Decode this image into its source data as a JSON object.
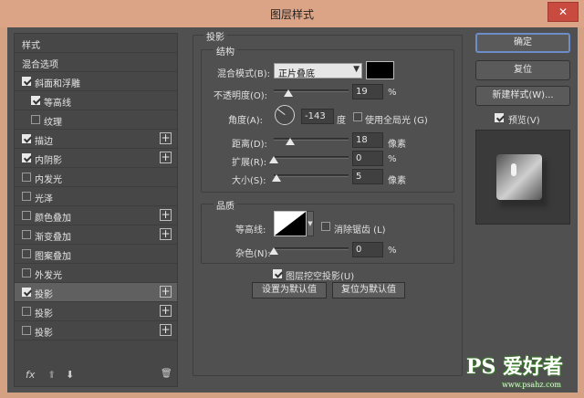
{
  "window": {
    "title": "图层样式",
    "close": "✕"
  },
  "styles_list": {
    "items": [
      {
        "label": "样式",
        "checkbox": false,
        "plus": false,
        "indent": 0,
        "selected": false
      },
      {
        "label": "混合选项",
        "checkbox": false,
        "plus": false,
        "indent": 0,
        "selected": false
      },
      {
        "label": "斜面和浮雕",
        "checkbox": true,
        "checked": true,
        "plus": false,
        "indent": 0,
        "selected": false
      },
      {
        "label": "等高线",
        "checkbox": true,
        "checked": true,
        "plus": false,
        "indent": 1,
        "selected": false
      },
      {
        "label": "纹理",
        "checkbox": true,
        "checked": false,
        "plus": false,
        "indent": 1,
        "selected": false
      },
      {
        "label": "描边",
        "checkbox": true,
        "checked": true,
        "plus": true,
        "indent": 0,
        "selected": false
      },
      {
        "label": "内阴影",
        "checkbox": true,
        "checked": true,
        "plus": true,
        "indent": 0,
        "selected": false
      },
      {
        "label": "内发光",
        "checkbox": true,
        "checked": false,
        "plus": false,
        "indent": 0,
        "selected": false
      },
      {
        "label": "光泽",
        "checkbox": true,
        "checked": false,
        "plus": false,
        "indent": 0,
        "selected": false
      },
      {
        "label": "颜色叠加",
        "checkbox": true,
        "checked": false,
        "plus": true,
        "indent": 0,
        "selected": false
      },
      {
        "label": "渐变叠加",
        "checkbox": true,
        "checked": false,
        "plus": true,
        "indent": 0,
        "selected": false
      },
      {
        "label": "图案叠加",
        "checkbox": true,
        "checked": false,
        "plus": false,
        "indent": 0,
        "selected": false
      },
      {
        "label": "外发光",
        "checkbox": true,
        "checked": false,
        "plus": false,
        "indent": 0,
        "selected": false
      },
      {
        "label": "投影",
        "checkbox": true,
        "checked": true,
        "plus": true,
        "indent": 0,
        "selected": true
      },
      {
        "label": "投影",
        "checkbox": true,
        "checked": false,
        "plus": true,
        "indent": 0,
        "selected": false
      },
      {
        "label": "投影",
        "checkbox": true,
        "checked": false,
        "plus": true,
        "indent": 0,
        "selected": false
      }
    ],
    "footer": {
      "fx": "fx",
      "up": "⬆",
      "down": "⬇",
      "trash": "🗑"
    }
  },
  "shadow": {
    "section_title": "投影",
    "structure": {
      "title": "结构",
      "blend_label": "混合模式(B):",
      "blend_value": "正片叠底",
      "blend_color": "#000000",
      "opacity_label": "不透明度(O):",
      "opacity_value": "19",
      "opacity_unit": "%",
      "opacity_level": 0.19,
      "angle_label": "角度(A):",
      "angle_value": "-143",
      "angle_unit": "度",
      "global_light_label": "使用全局光 (G)",
      "global_light_checked": false,
      "distance_label": "距离(D):",
      "distance_value": "18",
      "distance_unit": "像素",
      "spread_label": "扩展(R):",
      "spread_value": "0",
      "spread_unit": "%",
      "size_label": "大小(S):",
      "size_value": "5",
      "size_unit": "像素"
    },
    "quality": {
      "title": "品质",
      "contour_label": "等高线:",
      "antialias_label": "消除锯齿 (L)",
      "antialias_checked": false,
      "noise_label": "杂色(N):",
      "noise_value": "0",
      "noise_unit": "%"
    },
    "knockout_label": "图层挖空投影(U)",
    "knockout_checked": true,
    "make_default": "设置为默认值",
    "reset_default": "复位为默认值"
  },
  "actions": {
    "ok": "确定",
    "reset": "复位",
    "new_style": "新建样式(W)...",
    "preview_label": "预览(V)",
    "preview_checked": true
  },
  "watermark": {
    "text": "PS 爱好者",
    "url": "www.psahz.com"
  }
}
